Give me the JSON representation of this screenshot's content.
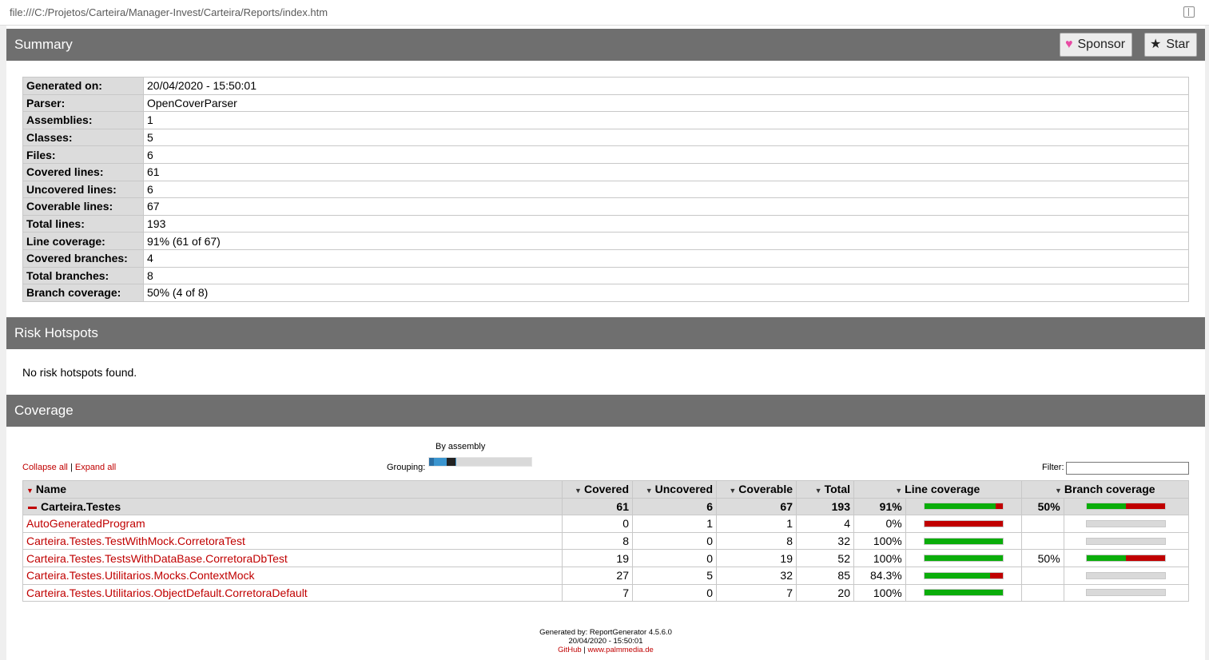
{
  "browser": {
    "url": "file:///C:/Projetos/Carteira/Manager-Invest/Carteira/Reports/index.htm",
    "reader_icon": "reader-view-icon"
  },
  "summary": {
    "title": "Summary",
    "sponsor_label": "Sponsor",
    "star_label": "Star",
    "rows": [
      {
        "label": "Generated on:",
        "value": "20/04/2020 - 15:50:01"
      },
      {
        "label": "Parser:",
        "value": "OpenCoverParser"
      },
      {
        "label": "Assemblies:",
        "value": "1"
      },
      {
        "label": "Classes:",
        "value": "5"
      },
      {
        "label": "Files:",
        "value": "6"
      },
      {
        "label": "Covered lines:",
        "value": "61"
      },
      {
        "label": "Uncovered lines:",
        "value": "6"
      },
      {
        "label": "Coverable lines:",
        "value": "67"
      },
      {
        "label": "Total lines:",
        "value": "193"
      },
      {
        "label": "Line coverage:",
        "value": "91% (61 of 67)"
      },
      {
        "label": "Covered branches:",
        "value": "4"
      },
      {
        "label": "Total branches:",
        "value": "8"
      },
      {
        "label": "Branch coverage:",
        "value": "50% (4 of 8)"
      }
    ]
  },
  "risk": {
    "title": "Risk Hotspots",
    "message": "No risk hotspots found."
  },
  "coverage": {
    "title": "Coverage",
    "collapse_all": "Collapse all",
    "separator": "|",
    "expand_all": "Expand all",
    "grouping_label": "Grouping:",
    "grouping_value": "By assembly",
    "filter_label": "Filter:",
    "filter_value": "",
    "columns": {
      "name": "Name",
      "covered": "Covered",
      "uncovered": "Uncovered",
      "coverable": "Coverable",
      "total": "Total",
      "line_coverage": "Line coverage",
      "branch_coverage": "Branch coverage"
    },
    "assembly": {
      "name": "Carteira.Testes",
      "covered": "61",
      "uncovered": "6",
      "coverable": "67",
      "total": "193",
      "line_pct": "91%",
      "line_fraction": 0.91,
      "branch_pct": "50%",
      "branch_fraction": 0.5
    },
    "classes": [
      {
        "name": "AutoGeneratedProgram",
        "covered": "0",
        "uncovered": "1",
        "coverable": "1",
        "total": "4",
        "line_pct": "0%",
        "line_fraction": 0,
        "branch_pct": "",
        "branch_fraction": null
      },
      {
        "name": "Carteira.Testes.TestWithMock.CorretoraTest",
        "covered": "8",
        "uncovered": "0",
        "coverable": "8",
        "total": "32",
        "line_pct": "100%",
        "line_fraction": 1,
        "branch_pct": "",
        "branch_fraction": null
      },
      {
        "name": "Carteira.Testes.TestsWithDataBase.CorretoraDbTest",
        "covered": "19",
        "uncovered": "0",
        "coverable": "19",
        "total": "52",
        "line_pct": "100%",
        "line_fraction": 1,
        "branch_pct": "50%",
        "branch_fraction": 0.5
      },
      {
        "name": "Carteira.Testes.Utilitarios.Mocks.ContextMock",
        "covered": "27",
        "uncovered": "5",
        "coverable": "32",
        "total": "85",
        "line_pct": "84.3%",
        "line_fraction": 0.843,
        "branch_pct": "",
        "branch_fraction": null
      },
      {
        "name": "Carteira.Testes.Utilitarios.ObjectDefault.CorretoraDefault",
        "covered": "7",
        "uncovered": "0",
        "coverable": "7",
        "total": "20",
        "line_pct": "100%",
        "line_fraction": 1,
        "branch_pct": "",
        "branch_fraction": null
      }
    ]
  },
  "footer": {
    "line1": "Generated by: ReportGenerator 4.5.6.0",
    "line2": "20/04/2020 - 15:50:01",
    "github": "GitHub",
    "sep": "|",
    "site": "www.palmmedia.de"
  },
  "colors": {
    "header_bg": "#6f6f6f",
    "link": "#c00000",
    "covered": "#0aad0a",
    "uncovered": "#c00000",
    "empty": "#d9d9d9"
  }
}
